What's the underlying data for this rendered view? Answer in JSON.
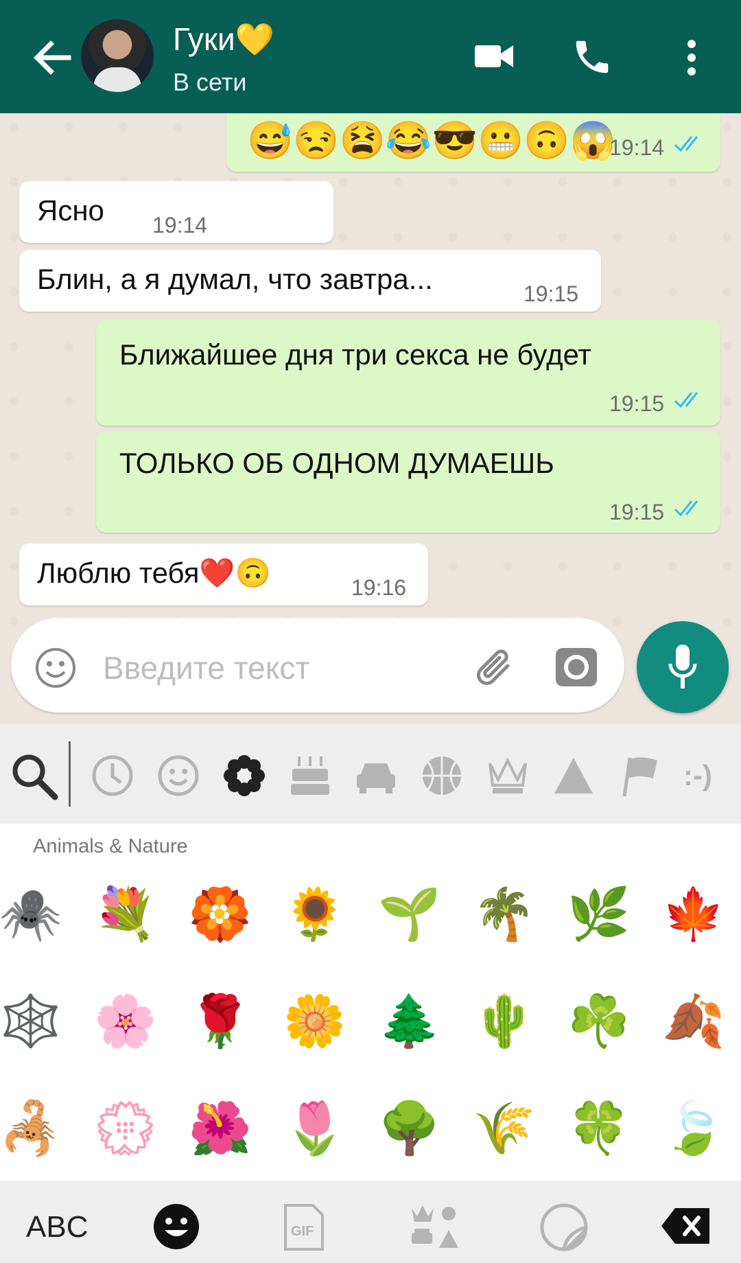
{
  "header": {
    "contact_name": "Гуки",
    "name_emoji": "💛",
    "status": "В сети",
    "colors": {
      "bar": "#075e54"
    }
  },
  "messages": [
    {
      "direction": "out",
      "text": "😅😒😫😂😎😬🙃😱",
      "time": "19:14",
      "read": true
    },
    {
      "direction": "in",
      "text": "Ясно",
      "time": "19:14"
    },
    {
      "direction": "in",
      "text": "Блин, а я думал, что завтра...",
      "time": "19:15"
    },
    {
      "direction": "out",
      "text": "Ближайшее дня три секса не будет",
      "time": "19:15",
      "read": true
    },
    {
      "direction": "out",
      "text": "ТОЛЬКО ОБ ОДНОМ ДУМАЕШЬ",
      "time": "19:15",
      "read": true
    },
    {
      "direction": "in",
      "text": "Люблю тебя❤️🙃",
      "time": "19:16"
    }
  ],
  "composer": {
    "placeholder": "Введите текст"
  },
  "emoji_keyboard": {
    "categories": [
      "search-icon",
      "recent-clock-icon",
      "smiley-icon",
      "flower-icon",
      "cake-icon",
      "car-icon",
      "basketball-icon",
      "crown-icon",
      "triangle-icon",
      "flag-icon",
      "emoticon-text-icon"
    ],
    "emoticon_label": ":-)",
    "section_title": "Animals & Nature",
    "rows": [
      [
        "🕷️",
        "💐",
        "🏵️",
        "🌻",
        "🌱",
        "🌴",
        "🌿",
        "🍁"
      ],
      [
        "🕸️",
        "🌸",
        "🌹",
        "🌼",
        "🌲",
        "🌵",
        "☘️",
        "🍂"
      ],
      [
        "🦂",
        "💮",
        "🌺",
        "🌷",
        "🌳",
        "🌾",
        "🍀",
        "🍃"
      ]
    ],
    "bottom": {
      "abc_label": "ABC",
      "gif_label": "GIF"
    }
  }
}
